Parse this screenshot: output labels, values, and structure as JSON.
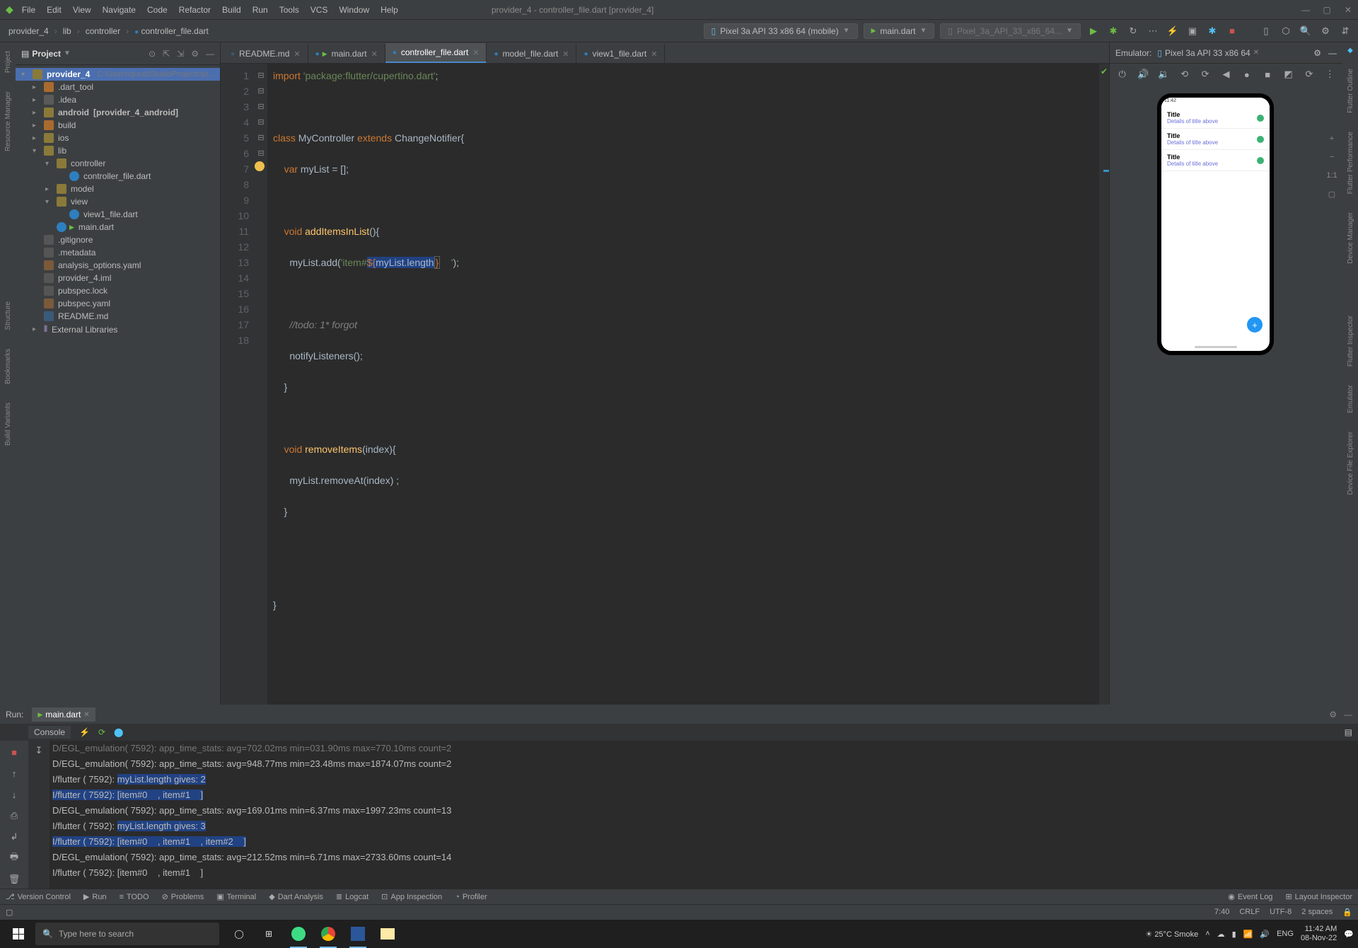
{
  "menu": {
    "items": [
      "File",
      "Edit",
      "View",
      "Navigate",
      "Code",
      "Refactor",
      "Build",
      "Run",
      "Tools",
      "VCS",
      "Window",
      "Help"
    ],
    "title": "provider_4 - controller_file.dart [provider_4]"
  },
  "breadcrumb": [
    "provider_4",
    "lib",
    "controller",
    "controller_file.dart"
  ],
  "toolbar": {
    "device": "Pixel 3a API 33 x86 64 (mobile)",
    "config": "main.dart",
    "target": "Pixel_3a_API_33_x86_64..."
  },
  "project": {
    "panel": "Project",
    "root": {
      "name": "provider_4",
      "path": "C:\\Users\\qurat\\StudioProjects\\pr..."
    },
    "nodes": [
      {
        "t": "folder",
        "l": ".dart_tool",
        "i": 1,
        "exp": false,
        "cls": "orange"
      },
      {
        "t": "folder",
        "l": ".idea",
        "i": 1,
        "exp": false,
        "cls": "dark"
      },
      {
        "t": "folder",
        "l": "android",
        "suffix": "[provider_4_android]",
        "i": 1,
        "exp": false,
        "bold": true
      },
      {
        "t": "folder",
        "l": "build",
        "i": 1,
        "exp": false,
        "cls": "orange"
      },
      {
        "t": "folder",
        "l": "ios",
        "i": 1,
        "exp": false
      },
      {
        "t": "folder",
        "l": "lib",
        "i": 1,
        "exp": true
      },
      {
        "t": "folder",
        "l": "controller",
        "i": 2,
        "exp": true
      },
      {
        "t": "dart",
        "l": "controller_file.dart",
        "i": 3
      },
      {
        "t": "folder",
        "l": "model",
        "i": 2,
        "exp": false
      },
      {
        "t": "folder",
        "l": "view",
        "i": 2,
        "exp": true
      },
      {
        "t": "dart",
        "l": "view1_file.dart",
        "i": 3
      },
      {
        "t": "dart",
        "l": "main.dart",
        "i": 2,
        "main": true
      },
      {
        "t": "txt",
        "l": ".gitignore",
        "i": 1
      },
      {
        "t": "txt",
        "l": ".metadata",
        "i": 1
      },
      {
        "t": "yaml",
        "l": "analysis_options.yaml",
        "i": 1
      },
      {
        "t": "txt",
        "l": "provider_4.iml",
        "i": 1
      },
      {
        "t": "txt",
        "l": "pubspec.lock",
        "i": 1
      },
      {
        "t": "yaml",
        "l": "pubspec.yaml",
        "i": 1
      },
      {
        "t": "md",
        "l": "README.md",
        "i": 1
      }
    ],
    "externals": "External Libraries"
  },
  "tabs": [
    {
      "name": "README.md",
      "icon": "md"
    },
    {
      "name": "main.dart",
      "icon": "dart",
      "main": true
    },
    {
      "name": "controller_file.dart",
      "icon": "dart",
      "active": true
    },
    {
      "name": "model_file.dart",
      "icon": "dart"
    },
    {
      "name": "view1_file.dart",
      "icon": "dart"
    }
  ],
  "code": {
    "lines": [
      1,
      2,
      3,
      4,
      5,
      6,
      7,
      8,
      9,
      10,
      11,
      12,
      13,
      14,
      15,
      16,
      17,
      18
    ],
    "l1_kw": "import",
    "l1_str": "'package:flutter/cupertino.dart'",
    "l1_end": ";",
    "l3": "class MyController extends ChangeNotifier{",
    "l4": "    var myList = [];",
    "l6": "    void addItemsInList(){",
    "l7a": "      myList.add(",
    "l7b": "'item#",
    "l7c": "${",
    "l7d": "myList.length",
    "l7e": "}",
    "l7f": "    '",
    "l7g": ");",
    "l9": "      //todo: 1* forgot",
    "l10": "      notifyListeners();",
    "l11": "    }",
    "l13": "    void removeItems(index){",
    "l14": "      myList.removeAt(index) ;",
    "l15": "    }",
    "l18": "}"
  },
  "emulator": {
    "panel": "Emulator:",
    "device": "Pixel 3a API 33 x86 64",
    "statusTime": "11:42",
    "rows": [
      {
        "t": "Title",
        "s": "Details of title above"
      },
      {
        "t": "Title",
        "s": "Details of title above"
      },
      {
        "t": "Title",
        "s": "Details of title above"
      }
    ],
    "zoom": {
      "plus": "+",
      "minus": "−",
      "ratio": "1:1"
    }
  },
  "run": {
    "label": "Run:",
    "tab": "main.dart",
    "console": "Console",
    "lines": [
      {
        "t": "D/EGL_emulation( 7592): app_time_stats: avg=948.77ms min=23.48ms max=1874.07ms count=2",
        "h": false
      },
      {
        "t": "I/flutter ( 7592): myList.length gives: 2",
        "h": true,
        "pre": "I/flutter ( 7592): "
      },
      {
        "t": "I/flutter ( 7592): [item#0    , item#1    ]",
        "h": true
      },
      {
        "t": "D/EGL_emulation( 7592): app_time_stats: avg=169.01ms min=6.37ms max=1997.23ms count=13",
        "h": false
      },
      {
        "t": "I/flutter ( 7592): myList.length gives: 3",
        "h": true,
        "pre": "I/flutter ( 7592): "
      },
      {
        "t": "I/flutter ( 7592): [item#0    , item#1    , item#2    ]",
        "h": true
      },
      {
        "t": "D/EGL_emulation( 7592): app_time_stats: avg=212.52ms min=6.71ms max=2733.60ms count=14",
        "h": false
      },
      {
        "t": "I/flutter ( 7592): [item#0    , item#1    ]",
        "h": false
      }
    ]
  },
  "bottom": {
    "items": [
      "Version Control",
      "Run",
      "TODO",
      "Problems",
      "Terminal",
      "Dart Analysis",
      "Logcat",
      "App Inspection",
      "Profiler"
    ],
    "right": [
      "Event Log",
      "Layout Inspector"
    ]
  },
  "status": {
    "caret": "7:40",
    "lf": "CRLF",
    "enc": "UTF-8",
    "indent": "2 spaces"
  },
  "taskbar": {
    "search": "Type here to search",
    "weather": "25°C  Smoke",
    "lang": "ENG",
    "time": "11:42 AM",
    "date": "08-Nov-22"
  },
  "leftstrips": [
    "Project",
    "Resource Manager",
    "Structure",
    "Bookmarks",
    "Build Variants"
  ],
  "rightstrips": [
    "Flutter Outline",
    "Flutter Performance",
    "Device Manager",
    "Flutter Inspector",
    "Emulator",
    "Device File Explorer"
  ]
}
